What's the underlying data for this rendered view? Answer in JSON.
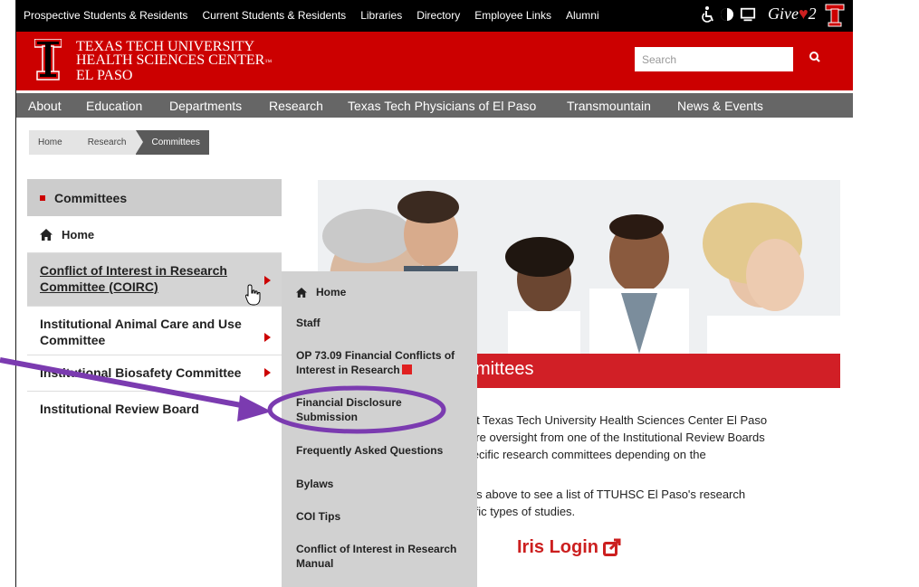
{
  "topbar": {
    "links": [
      "Prospective Students & Residents",
      "Current Students & Residents",
      "Libraries",
      "Directory",
      "Employee Links",
      "Alumni"
    ],
    "give_label": "Give",
    "give_num": "2"
  },
  "header": {
    "university_lines": [
      "TEXAS TECH UNIVERSITY",
      "HEALTH SCIENCES CENTER",
      "EL PASO"
    ],
    "tm": "™",
    "search_placeholder": "Search"
  },
  "nav": {
    "items": [
      "About",
      "Education",
      "Departments",
      "Research",
      "Texas Tech Physicians of El Paso",
      "Transmountain",
      "News & Events"
    ]
  },
  "breadcrumb": [
    "Home",
    "Research",
    "Committees"
  ],
  "sidebar": {
    "heading": "Committees",
    "home": "Home",
    "items": [
      "Conflict of Interest in Research Committee (COIRC)",
      "Institutional Animal Care and Use Committee",
      "Institutional Biosafety Committee",
      "Institutional Review Board"
    ]
  },
  "main": {
    "banner_title": "mittees",
    "paragraph1": [
      "d at Texas Tech University Health Sciences Center El Paso",
      "quire oversight from one of the Institutional Review Boards",
      "specific research committees depending on the"
    ],
    "paragraph2": [
      "tabs above to see a list of TTUHSC El Paso's research",
      "ecific types of studies."
    ],
    "iris_login": "Iris Login"
  },
  "submenu": {
    "items": [
      "Home",
      "Staff",
      "OP 73.09 Financial Conflicts of Interest in Research",
      "Financial Disclosure Submission",
      "Frequently Asked Questions",
      "Bylaws",
      "COI Tips",
      "Conflict of Interest in Research Manual"
    ]
  },
  "colors": {
    "brand_red": "#cc0000",
    "nav_gray": "#666666",
    "annotation_purple": "#7b3bb0"
  }
}
